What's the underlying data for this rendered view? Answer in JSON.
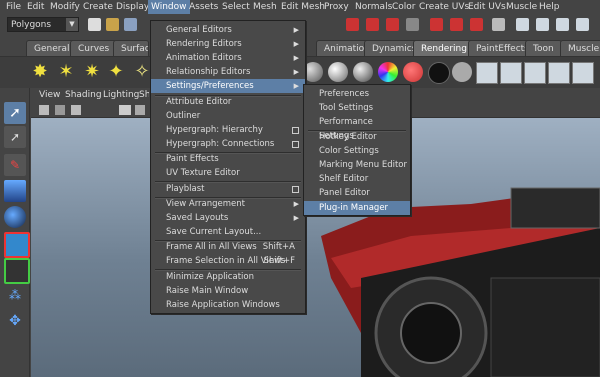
{
  "menubar": {
    "items": [
      "File",
      "Edit",
      "Modify",
      "Create",
      "Display",
      "Window",
      "Assets",
      "Select",
      "Mesh",
      "Edit Mesh",
      "Proxy",
      "Normals",
      "Color",
      "Create UVs",
      "Edit UVs",
      "Muscle",
      "Help"
    ]
  },
  "statusline": {
    "mode": "Polygons"
  },
  "shelf_tabs": [
    "General",
    "Curves",
    "Surfaces",
    "Animation",
    "Dynamics",
    "Rendering",
    "PaintEffects",
    "Toon",
    "Muscle"
  ],
  "panel_menu": [
    "View",
    "Shading",
    "Lighting",
    "Show"
  ],
  "window_menu": {
    "items": [
      {
        "label": "General Editors",
        "type": "sub"
      },
      {
        "label": "Rendering Editors",
        "type": "sub"
      },
      {
        "label": "Animation Editors",
        "type": "sub"
      },
      {
        "label": "Relationship Editors",
        "type": "sub"
      },
      {
        "label": "Settings/Preferences",
        "type": "sub",
        "active": true
      },
      {
        "label": "Attribute Editor",
        "type": "plain"
      },
      {
        "label": "Outliner",
        "type": "plain"
      },
      {
        "label": "Hypergraph: Hierarchy",
        "type": "box"
      },
      {
        "label": "Hypergraph: Connections",
        "type": "box"
      },
      {
        "label": "Paint Effects",
        "type": "plain"
      },
      {
        "label": "UV Texture Editor",
        "type": "plain"
      },
      {
        "label": "Playblast",
        "type": "box"
      },
      {
        "label": "View Arrangement",
        "type": "sub"
      },
      {
        "label": "Saved Layouts",
        "type": "sub"
      },
      {
        "label": "Save Current Layout...",
        "type": "plain"
      },
      {
        "label": "Frame All in All Views",
        "type": "shortcut",
        "shortcut": "Shift+A"
      },
      {
        "label": "Frame Selection in All Views",
        "type": "shortcut",
        "shortcut": "Shift+F"
      },
      {
        "label": "Minimize Application",
        "type": "plain"
      },
      {
        "label": "Raise Main Window",
        "type": "plain"
      },
      {
        "label": "Raise Application Windows",
        "type": "plain"
      }
    ]
  },
  "settings_submenu": {
    "items": [
      {
        "label": "Preferences"
      },
      {
        "label": "Tool Settings"
      },
      {
        "label": "Performance Settings"
      },
      {
        "label": "Hotkey Editor"
      },
      {
        "label": "Color Settings"
      },
      {
        "label": "Marking Menu Editor"
      },
      {
        "label": "Shelf Editor"
      },
      {
        "label": "Panel Editor"
      },
      {
        "label": "Plug-in Manager",
        "active": true
      }
    ]
  },
  "icons": {
    "shelf": [
      "directional-light-icon",
      "ambient-light-icon",
      "point-light-icon",
      "spot-light-icon",
      "area-light-icon",
      "volume-light-icon"
    ],
    "toolbox": [
      "select-tool-icon",
      "lasso-tool-icon",
      "paint-select-tool-icon",
      "cone-primitive-icon",
      "sphere-primitive-icon",
      "cube-primitive-icon",
      "wire-cube-icon",
      "particles-icon",
      "move-tool-icon"
    ]
  },
  "colors": {
    "highlight": "#5d7fa6",
    "menu_bg": "#494949",
    "ui_bg": "#444444"
  }
}
